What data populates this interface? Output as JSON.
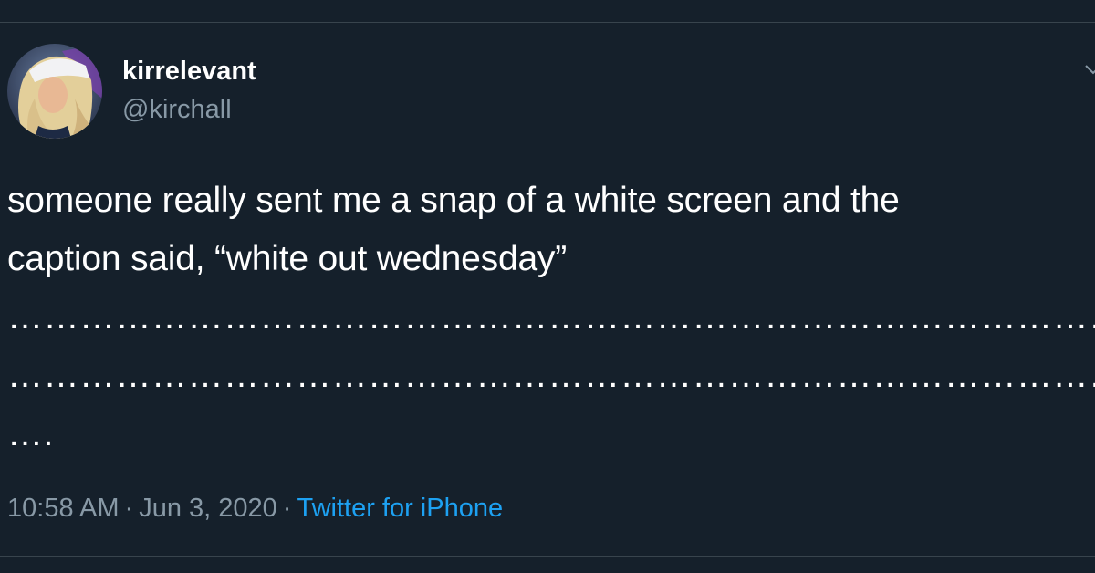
{
  "user": {
    "display_name": "kirrelevant",
    "handle": "@kirchall"
  },
  "tweet": {
    "lines": [
      "someone really sent me a snap of a white screen and the",
      "caption said, “white out wednesday”",
      "………………………………………………………………………………………………………………………………………",
      "………………………………………………………………………………………………………………………………………",
      "…."
    ]
  },
  "meta": {
    "time": "10:58 AM",
    "separator": "·",
    "date": "Jun 3, 2020",
    "source": "Twitter for iPhone"
  },
  "icons": {
    "avatar": "profile-photo",
    "caret": "chevron-down-icon"
  },
  "colors": {
    "background": "#15202b",
    "text": "#ffffff",
    "secondary_text": "#8899a6",
    "link": "#1da1f2",
    "divider": "#38444d"
  }
}
